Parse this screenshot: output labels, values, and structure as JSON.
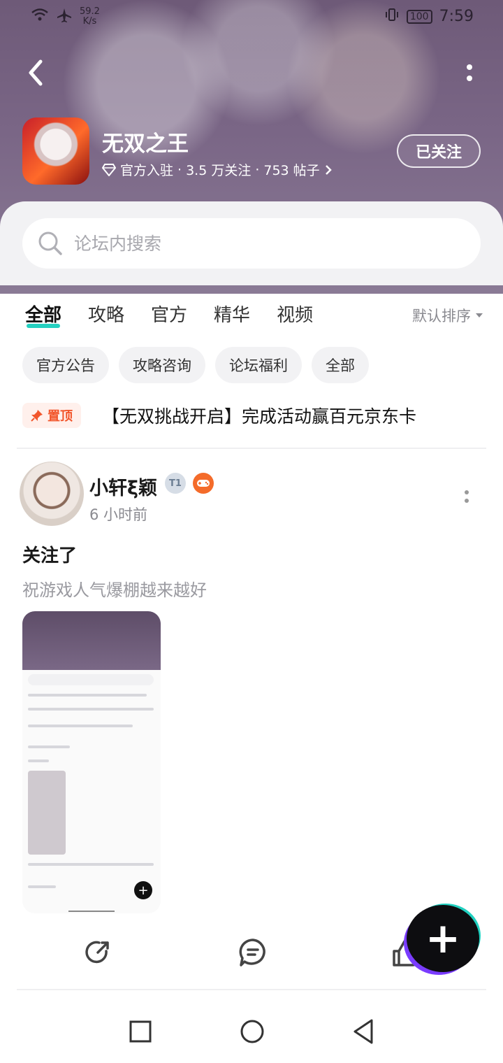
{
  "status_bar": {
    "speed_value": "59.2",
    "speed_unit": "K/s",
    "battery": "100",
    "time": "7:59"
  },
  "header": {
    "app_title": "无双之王",
    "official": "官方入驻",
    "followers": "3.5 万关注",
    "posts": "753 帖子",
    "meta_sep": "·",
    "follow_label": "已关注"
  },
  "search": {
    "placeholder": "论坛内搜索"
  },
  "tabs": [
    {
      "label": "全部",
      "active": true
    },
    {
      "label": "攻略"
    },
    {
      "label": "官方"
    },
    {
      "label": "精华"
    },
    {
      "label": "视频"
    }
  ],
  "sort_label": "默认排序",
  "chips": [
    "官方公告",
    "攻略咨询",
    "论坛福利",
    "全部"
  ],
  "pinned": {
    "badge": "置顶",
    "title": "【无双挑战开启】完成活动赢百元京东卡"
  },
  "post": {
    "username": "小轩ξ颖",
    "level_badge": "T1",
    "time": "6 小时前",
    "title": "关注了",
    "body": "祝游戏人气爆棚越来越好"
  },
  "colors": {
    "accent": "#25d0c0",
    "pin": "#f2562c",
    "header_bg": "#7a6686"
  },
  "icons": [
    "back-icon",
    "more-icon",
    "diamond-icon",
    "chevron-right-icon",
    "search-icon",
    "sort-caret-icon",
    "pin-icon",
    "share-icon",
    "comment-icon",
    "like-icon",
    "plus-icon"
  ]
}
